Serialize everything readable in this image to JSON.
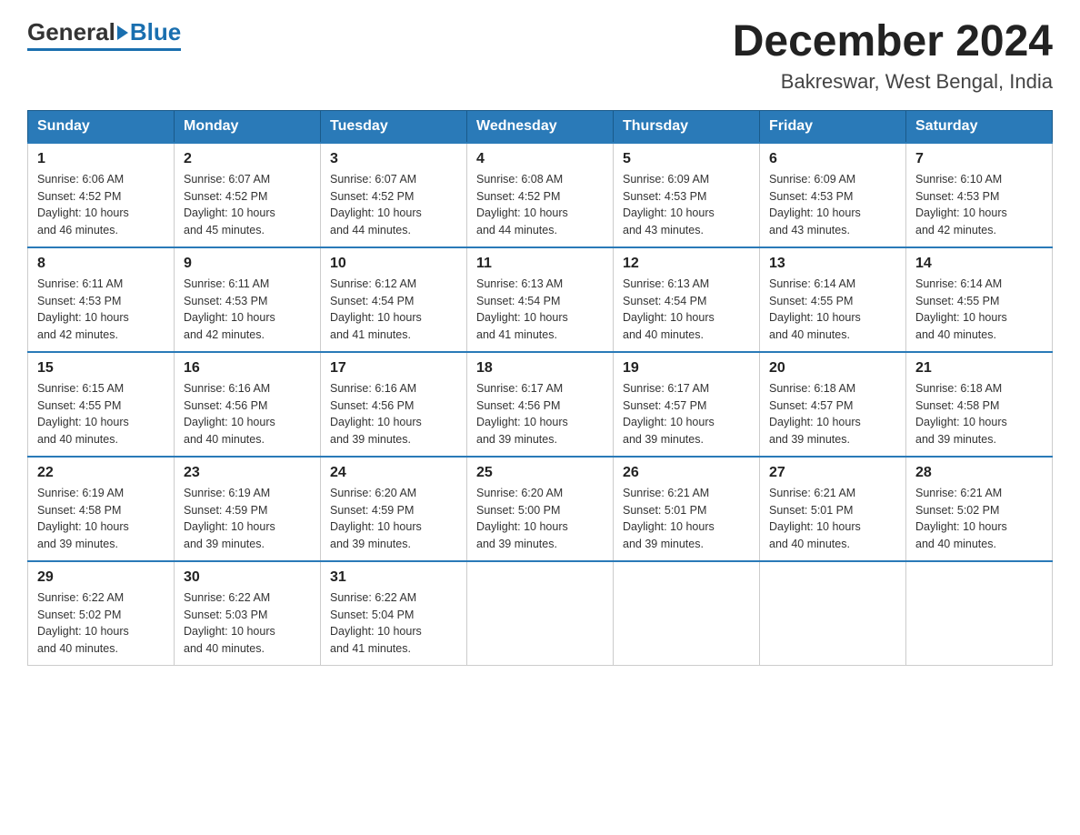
{
  "header": {
    "logo": {
      "general": "General",
      "blue": "Blue"
    },
    "title": "December 2024",
    "location": "Bakreswar, West Bengal, India"
  },
  "weekdays": [
    "Sunday",
    "Monday",
    "Tuesday",
    "Wednesday",
    "Thursday",
    "Friday",
    "Saturday"
  ],
  "weeks": [
    [
      {
        "day": "1",
        "sunrise": "6:06 AM",
        "sunset": "4:52 PM",
        "daylight": "10 hours and 46 minutes."
      },
      {
        "day": "2",
        "sunrise": "6:07 AM",
        "sunset": "4:52 PM",
        "daylight": "10 hours and 45 minutes."
      },
      {
        "day": "3",
        "sunrise": "6:07 AM",
        "sunset": "4:52 PM",
        "daylight": "10 hours and 44 minutes."
      },
      {
        "day": "4",
        "sunrise": "6:08 AM",
        "sunset": "4:52 PM",
        "daylight": "10 hours and 44 minutes."
      },
      {
        "day": "5",
        "sunrise": "6:09 AM",
        "sunset": "4:53 PM",
        "daylight": "10 hours and 43 minutes."
      },
      {
        "day": "6",
        "sunrise": "6:09 AM",
        "sunset": "4:53 PM",
        "daylight": "10 hours and 43 minutes."
      },
      {
        "day": "7",
        "sunrise": "6:10 AM",
        "sunset": "4:53 PM",
        "daylight": "10 hours and 42 minutes."
      }
    ],
    [
      {
        "day": "8",
        "sunrise": "6:11 AM",
        "sunset": "4:53 PM",
        "daylight": "10 hours and 42 minutes."
      },
      {
        "day": "9",
        "sunrise": "6:11 AM",
        "sunset": "4:53 PM",
        "daylight": "10 hours and 42 minutes."
      },
      {
        "day": "10",
        "sunrise": "6:12 AM",
        "sunset": "4:54 PM",
        "daylight": "10 hours and 41 minutes."
      },
      {
        "day": "11",
        "sunrise": "6:13 AM",
        "sunset": "4:54 PM",
        "daylight": "10 hours and 41 minutes."
      },
      {
        "day": "12",
        "sunrise": "6:13 AM",
        "sunset": "4:54 PM",
        "daylight": "10 hours and 40 minutes."
      },
      {
        "day": "13",
        "sunrise": "6:14 AM",
        "sunset": "4:55 PM",
        "daylight": "10 hours and 40 minutes."
      },
      {
        "day": "14",
        "sunrise": "6:14 AM",
        "sunset": "4:55 PM",
        "daylight": "10 hours and 40 minutes."
      }
    ],
    [
      {
        "day": "15",
        "sunrise": "6:15 AM",
        "sunset": "4:55 PM",
        "daylight": "10 hours and 40 minutes."
      },
      {
        "day": "16",
        "sunrise": "6:16 AM",
        "sunset": "4:56 PM",
        "daylight": "10 hours and 40 minutes."
      },
      {
        "day": "17",
        "sunrise": "6:16 AM",
        "sunset": "4:56 PM",
        "daylight": "10 hours and 39 minutes."
      },
      {
        "day": "18",
        "sunrise": "6:17 AM",
        "sunset": "4:56 PM",
        "daylight": "10 hours and 39 minutes."
      },
      {
        "day": "19",
        "sunrise": "6:17 AM",
        "sunset": "4:57 PM",
        "daylight": "10 hours and 39 minutes."
      },
      {
        "day": "20",
        "sunrise": "6:18 AM",
        "sunset": "4:57 PM",
        "daylight": "10 hours and 39 minutes."
      },
      {
        "day": "21",
        "sunrise": "6:18 AM",
        "sunset": "4:58 PM",
        "daylight": "10 hours and 39 minutes."
      }
    ],
    [
      {
        "day": "22",
        "sunrise": "6:19 AM",
        "sunset": "4:58 PM",
        "daylight": "10 hours and 39 minutes."
      },
      {
        "day": "23",
        "sunrise": "6:19 AM",
        "sunset": "4:59 PM",
        "daylight": "10 hours and 39 minutes."
      },
      {
        "day": "24",
        "sunrise": "6:20 AM",
        "sunset": "4:59 PM",
        "daylight": "10 hours and 39 minutes."
      },
      {
        "day": "25",
        "sunrise": "6:20 AM",
        "sunset": "5:00 PM",
        "daylight": "10 hours and 39 minutes."
      },
      {
        "day": "26",
        "sunrise": "6:21 AM",
        "sunset": "5:01 PM",
        "daylight": "10 hours and 39 minutes."
      },
      {
        "day": "27",
        "sunrise": "6:21 AM",
        "sunset": "5:01 PM",
        "daylight": "10 hours and 40 minutes."
      },
      {
        "day": "28",
        "sunrise": "6:21 AM",
        "sunset": "5:02 PM",
        "daylight": "10 hours and 40 minutes."
      }
    ],
    [
      {
        "day": "29",
        "sunrise": "6:22 AM",
        "sunset": "5:02 PM",
        "daylight": "10 hours and 40 minutes."
      },
      {
        "day": "30",
        "sunrise": "6:22 AM",
        "sunset": "5:03 PM",
        "daylight": "10 hours and 40 minutes."
      },
      {
        "day": "31",
        "sunrise": "6:22 AM",
        "sunset": "5:04 PM",
        "daylight": "10 hours and 41 minutes."
      },
      null,
      null,
      null,
      null
    ]
  ],
  "labels": {
    "sunrise": "Sunrise:",
    "sunset": "Sunset:",
    "daylight": "Daylight:"
  }
}
